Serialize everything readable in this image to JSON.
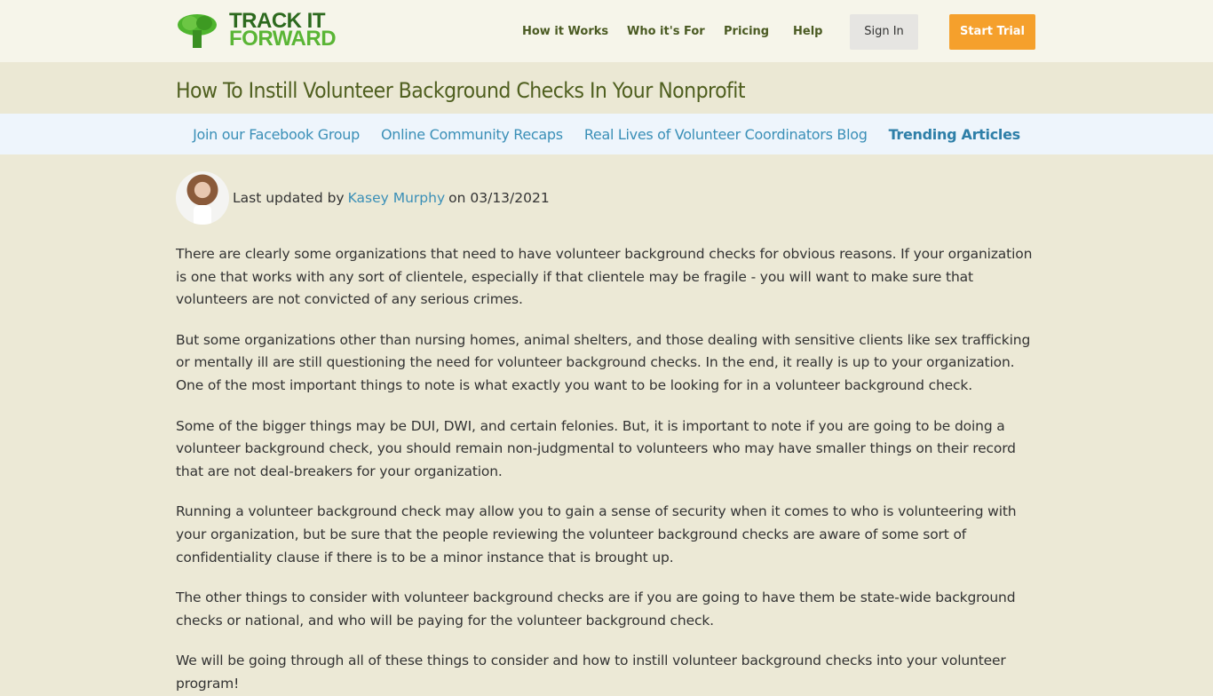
{
  "header": {
    "logo_line1": "TRACK IT",
    "logo_line2": "FORWARD",
    "nav": [
      {
        "label": "How it Works"
      },
      {
        "label": "Who it's For"
      },
      {
        "label": "Pricing"
      },
      {
        "label": "Help"
      }
    ],
    "sign_in_label": "Sign In",
    "start_trial_label": "Start Trial"
  },
  "page_title": "How To Instill Volunteer Background Checks In Your Nonprofit",
  "subnav": [
    {
      "label": "Join our Facebook Group"
    },
    {
      "label": "Online Community Recaps"
    },
    {
      "label": "Real Lives of Volunteer Coordinators Blog"
    },
    {
      "label": "Trending Articles"
    }
  ],
  "byline": {
    "prefix": "Last updated by",
    "author": "Kasey Murphy",
    "middle": "on",
    "date": "03/13/2021"
  },
  "article": {
    "paragraphs": [
      "There are clearly some organizations that need to have volunteer background checks for obvious reasons. If your organization is one that works with any sort of clientele, especially if that clientele may be fragile - you will want to make sure that volunteers are not convicted of any serious crimes.",
      "But some organizations other than nursing homes, animal shelters, and those dealing with sensitive clients like sex trafficking or mentally ill are still questioning the need for volunteer background checks. In the end, it really is up to your organization. One of the most important things to note is what exactly you want to be looking for in a volunteer background check.",
      "Some of the bigger things may be DUI, DWI, and certain felonies. But, it is important to note if you are going to be doing a volunteer background check, you should remain non-judgmental to volunteers who may have smaller things on their record that are not deal-breakers for your organization.",
      "Running a volunteer background check may allow you to gain a sense of security when it comes to who is volunteering with your organization, but be sure that the people reviewing the volunteer background checks are aware of some sort of confidentiality clause if there is to be a minor instance that is brought up.",
      "The other things to consider with volunteer background checks are if you are going to have them be state-wide background checks or national, and who will be paying for the volunteer background check.",
      "We will be going through all of these things to consider and how to instill volunteer background checks into your volunteer program!"
    ]
  }
}
